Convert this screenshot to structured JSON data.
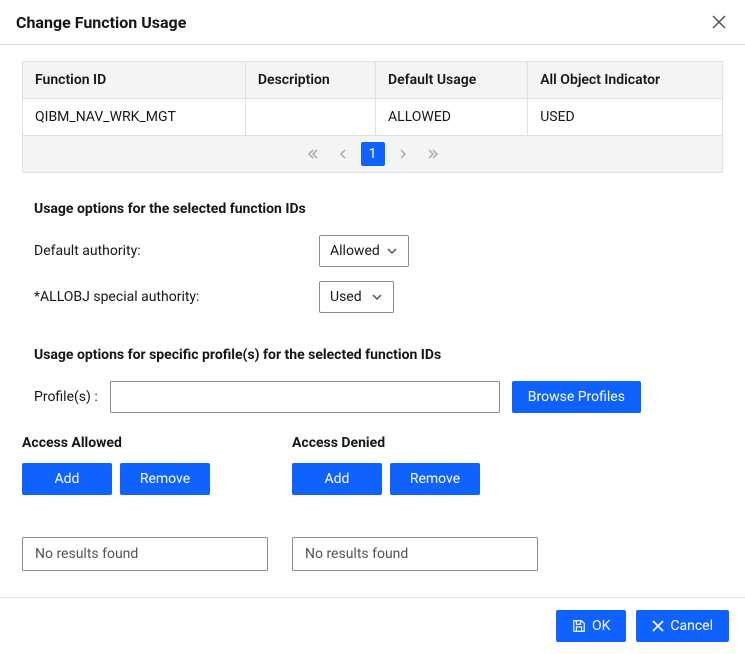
{
  "header": {
    "title": "Change Function Usage"
  },
  "table": {
    "columns": [
      "Function ID",
      "Description",
      "Default Usage",
      "All Object Indicator"
    ],
    "rows": [
      {
        "function_id": "QIBM_NAV_WRK_MGT",
        "description": "",
        "default_usage": "ALLOWED",
        "all_object_indicator": "USED"
      }
    ]
  },
  "pagination": {
    "current": "1"
  },
  "sections": {
    "usage_options_title": "Usage options for the selected function IDs",
    "default_authority_label": "Default authority:",
    "default_authority_value": "Allowed",
    "allobj_label": "*ALLOBJ special authority:",
    "allobj_value": "Used",
    "profile_section_title": "Usage options for specific profile(s) for the selected function IDs",
    "profiles_label": "Profile(s) :",
    "browse_profiles": "Browse Profiles",
    "access_allowed_title": "Access Allowed",
    "access_denied_title": "Access Denied",
    "add": "Add",
    "remove": "Remove",
    "no_results": "No results found"
  },
  "footer": {
    "ok": "OK",
    "cancel": "Cancel"
  }
}
